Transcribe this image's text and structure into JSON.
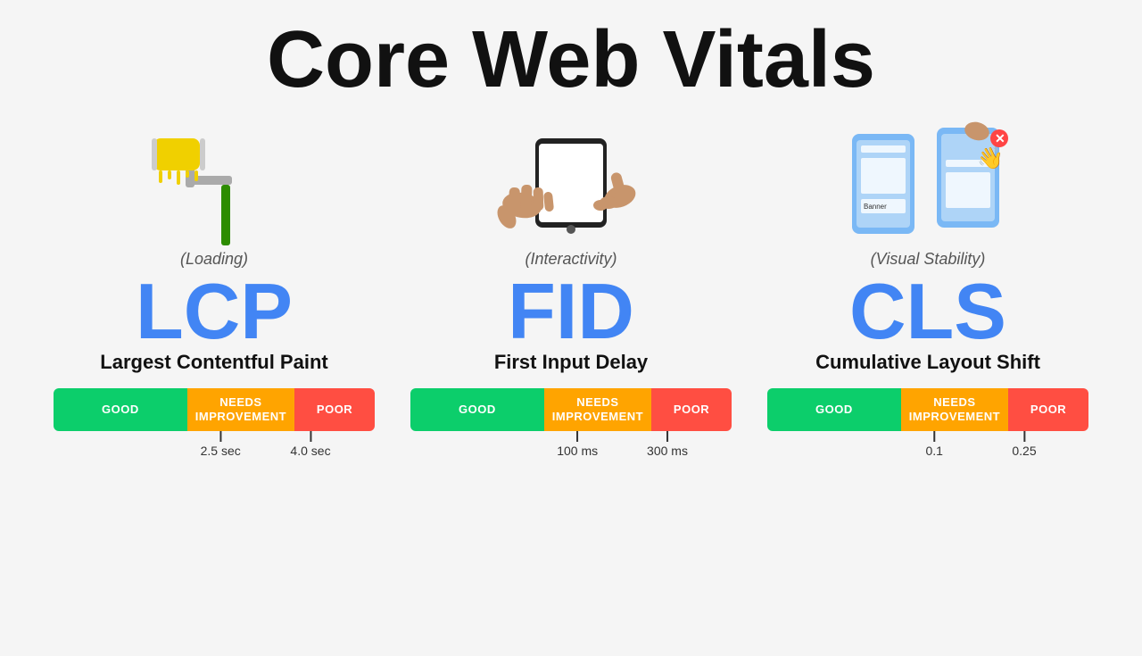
{
  "title": "Core Web Vitals",
  "metrics": [
    {
      "id": "lcp",
      "category": "(Loading)",
      "acronym": "LCP",
      "name": "Largest Contentful Paint",
      "good_label": "GOOD",
      "needs_label": "NEEDS\nIMPROVEMENT",
      "poor_label": "POOR",
      "tick1_label": "2.5 sec",
      "tick2_label": "4.0 sec",
      "tick1_pct": 52,
      "tick2_pct": 79
    },
    {
      "id": "fid",
      "category": "(Interactivity)",
      "acronym": "FID",
      "name": "First Input Delay",
      "good_label": "GOOD",
      "needs_label": "NEEDS\nIMPROVEMENT",
      "poor_label": "POOR",
      "tick1_label": "100 ms",
      "tick2_label": "300 ms",
      "tick1_pct": 52,
      "tick2_pct": 79
    },
    {
      "id": "cls",
      "category": "(Visual Stability)",
      "acronym": "CLS",
      "name": "Cumulative Layout Shift",
      "good_label": "GOOD",
      "needs_label": "NEEDS\nIMPROVEMENT",
      "poor_label": "POOR",
      "tick1_label": "0.1",
      "tick2_label": "0.25",
      "tick1_pct": 52,
      "tick2_pct": 79
    }
  ]
}
